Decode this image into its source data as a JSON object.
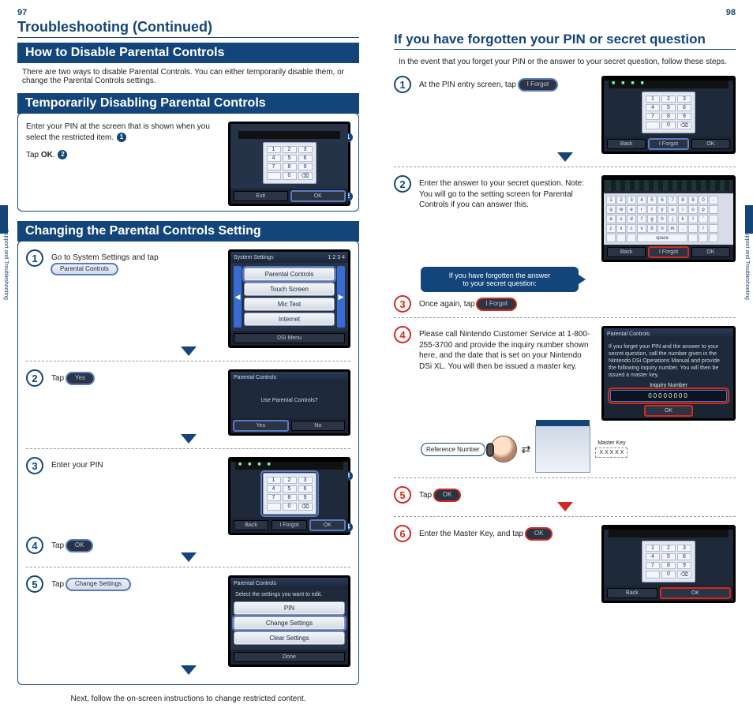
{
  "page_left_num": "97",
  "page_right_num": "98",
  "side_tab": "Support and Troubleshooting",
  "title_continued": "Troubleshooting (Continued)",
  "how_to_disable_heading": "How to Disable Parental Controls",
  "how_to_disable_intro": "There are two ways to disable Parental Controls. You can either temporarily disable them, or change the Parental Controls settings.",
  "temp_heading": "Temporarily Disabling Parental Controls",
  "temp_line1_a": "Enter your PIN at the screen that is shown when you select the restricted item.",
  "temp_line2_a": "Tap ",
  "temp_line2_b": "OK",
  "temp_line2_c": ".",
  "bullet_1": "1",
  "bullet_2": "2",
  "bullet_3": "3",
  "bullet_4": "4",
  "change_heading": "Changing the Parental Controls Setting",
  "change_step1_a": "Go to System Settings and tap",
  "pill_parental_controls": "Parental Controls",
  "change_step2": "Tap",
  "pill_yes": "Yes",
  "change_step3": "Enter your PIN",
  "change_step4": "Tap",
  "pill_ok_dark": "OK",
  "change_step5": "Tap",
  "pill_change_settings": "Change Settings",
  "change_footer": "Next, follow the on-screen instructions to change restricted content.",
  "forgot_heading": "If you have forgotten your PIN or secret question",
  "forgot_intro": "In the event that you forget your PIN or the answer to your secret question, follow these steps.",
  "forgot_step1_a": "At the PIN entry screen, tap",
  "pill_iforgot": "I Forgot",
  "forgot_step2": "Enter the answer to your secret question. Note: You will go to the setting screen for Parental Controls if you can answer this.",
  "blue_note_l1": "If you have forgotten the answer",
  "blue_note_l2": "to your secret question:",
  "forgot_step3_a": "Once again, tap",
  "forgot_step4": "Please call Nintendo Customer Service at 1-800-255-3700 and provide the inquiry number shown here, and the date that is set on your Nintendo DSi XL. You will then be issued a master key.",
  "ref_number_label": "Reference Number",
  "master_key_label": "Master Key",
  "master_key_mask": "X X X X X",
  "forgot_step5": "Tap",
  "forgot_step6_a": "Enter the Master Key, and tap",
  "ds_sys_title": "System Settings",
  "ds_sys_pages": "1   2   3   4",
  "ds_menu_parental": "Parental Controls",
  "ds_menu_touch": "Touch Screen",
  "ds_menu_mic": "Mic Test",
  "ds_menu_internet": "Internet",
  "ds_dsimenu": "DSi Menu",
  "ds_pc_title": "Parental Controls",
  "ds_pc_question": "Use Parental Controls?",
  "ds_btn_yes": "Yes",
  "ds_btn_no": "No",
  "ds_btn_back": "Back",
  "ds_btn_iforgot": "I Forgot",
  "ds_btn_ok": "OK",
  "ds_btn_exit": "Exit",
  "ds_pc_select": "Select the settings you want to edit.",
  "ds_opt_pin": "PIN",
  "ds_opt_change": "Change Settings",
  "ds_opt_clear": "Clear Settings",
  "ds_btn_done": "Done",
  "ds_pc_forgot_msg": "If you forget your PIN and the answer to your secret question, call the number given in the Nintendo DSi Operations Manual and provide the following inquiry number. You will then be issued a master key.",
  "ds_inquiry_label": "Inquiry Number",
  "ds_inquiry_value": "00000000",
  "pin_mask": "■ ■ ■ ■",
  "kb_row1": "1 2 3 4 5 6 7 8 9 0 -",
  "kb_row2": "q w e r t y u i o p",
  "kb_row3": "a s d f g h j k l '",
  "kb_row4": "z x c v b n m , . /",
  "kb_space": "space"
}
